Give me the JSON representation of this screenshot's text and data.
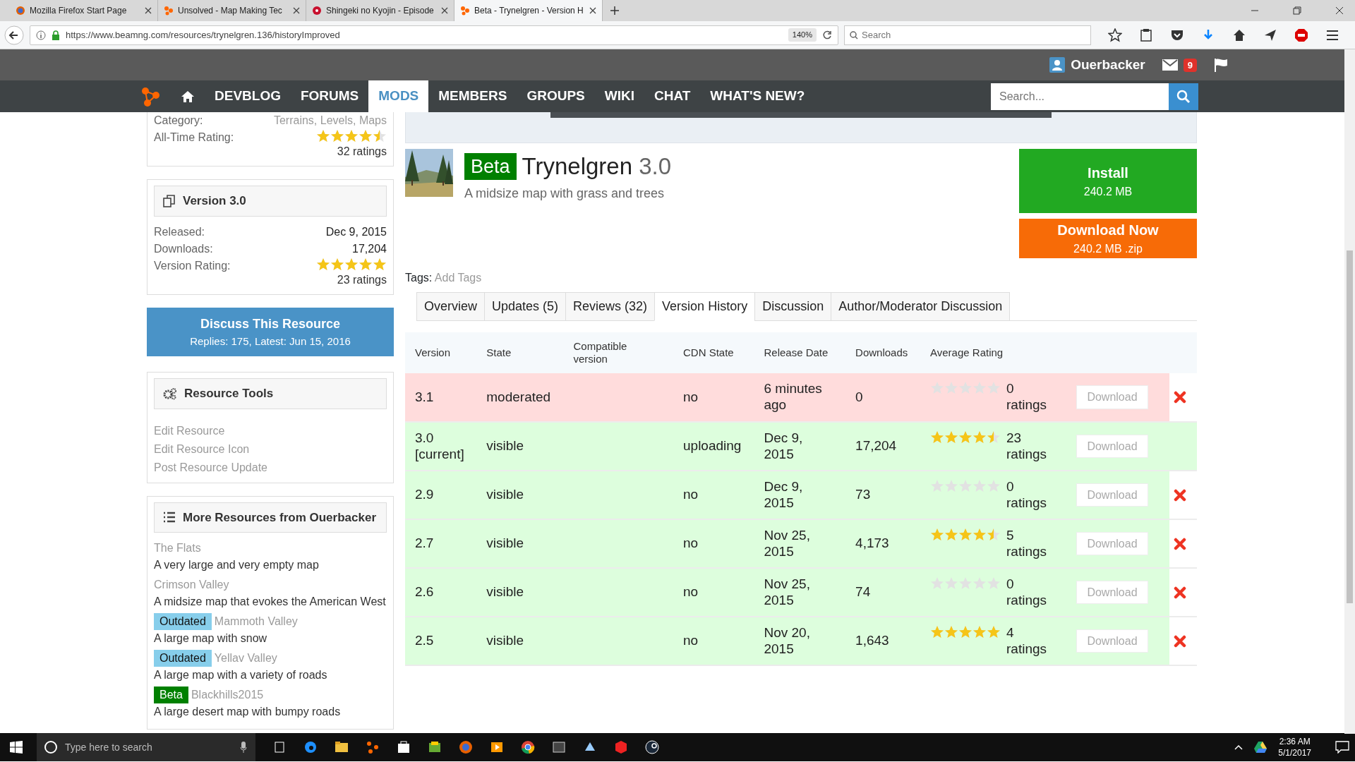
{
  "browser": {
    "tabs": [
      {
        "title": "Mozilla Firefox Start Page",
        "selected": false
      },
      {
        "title": "Unsolved - Map Making Tec",
        "selected": false
      },
      {
        "title": "Shingeki no Kyojin - Episode",
        "selected": false
      },
      {
        "title": "Beta - Trynelgren - Version H",
        "selected": true
      }
    ],
    "url": "https://www.beamng.com/resources/trynelgren.136/historyImproved",
    "zoom": "140%",
    "search_placeholder": "Search"
  },
  "site": {
    "username": "Ouerbacker",
    "message_count": "9",
    "search_placeholder": "Search...",
    "nav": [
      {
        "label": "DEVBLOG",
        "selected": false
      },
      {
        "label": "FORUMS",
        "selected": false
      },
      {
        "label": "MODS",
        "selected": true
      },
      {
        "label": "MEMBERS",
        "selected": false
      },
      {
        "label": "GROUPS",
        "selected": false
      },
      {
        "label": "WIKI",
        "selected": false
      },
      {
        "label": "CHAT",
        "selected": false
      },
      {
        "label": "WHAT'S NEW?",
        "selected": false
      }
    ]
  },
  "sidebar": {
    "info_rows": [
      {
        "label": "Category:",
        "value": "Terrains, Levels, Maps"
      },
      {
        "label": "All-Time Rating:",
        "stars": 4.5,
        "value": "32 ratings"
      }
    ],
    "version_card": {
      "title": "Version 3.0",
      "rows": [
        {
          "label": "Released:",
          "value": "Dec 9, 2015"
        },
        {
          "label": "Downloads:",
          "value": "17,204"
        },
        {
          "label": "Version Rating:",
          "stars": 5,
          "value": "23 ratings"
        }
      ]
    },
    "discuss": {
      "title": "Discuss This Resource",
      "subtitle": "Replies: 175, Latest: Jun 15, 2016"
    },
    "tools": {
      "title": "Resource Tools",
      "links": [
        "Edit Resource",
        "Edit Resource Icon",
        "Post Resource Update"
      ]
    },
    "more": {
      "title": "More Resources from Ouerbacker",
      "items": [
        {
          "title": "The Flats",
          "description": "A very large and very empty map"
        },
        {
          "title": "Crimson Valley",
          "description": "A midsize map that evokes the American West"
        },
        {
          "badge": "Outdated",
          "color": "#87ceeb",
          "title": "Mammoth Valley",
          "description": "A large map with snow"
        },
        {
          "badge": "Outdated",
          "color": "#87ceeb",
          "title": "Yellav Valley",
          "description": "A large map with a variety of roads"
        },
        {
          "badge": "Beta",
          "color": "#008000",
          "title": "Blackhills2015",
          "description": "A large desert map with bumpy roads"
        }
      ]
    }
  },
  "resource": {
    "badge": "Beta",
    "title": "Trynelgren",
    "version": "3.0",
    "tagline": "A midsize map with grass and trees",
    "install": {
      "label": "Install",
      "size": "240.2 MB"
    },
    "download": {
      "label": "Download Now",
      "size": "240.2 MB .zip"
    },
    "tags_label": "Tags:",
    "tags_link": "Add Tags",
    "tabs": [
      {
        "label": "Overview",
        "selected": false
      },
      {
        "label": "Updates (5)",
        "selected": false
      },
      {
        "label": "Reviews (32)",
        "selected": false
      },
      {
        "label": "Version History",
        "selected": true
      },
      {
        "label": "Discussion",
        "selected": false
      },
      {
        "label": "Author/Moderator Discussion",
        "selected": false
      }
    ]
  },
  "table": {
    "columns": [
      "Version",
      "State",
      "Compatible version",
      "CDN State",
      "Release Date",
      "Downloads",
      "Average Rating"
    ],
    "rows": [
      {
        "kind": "moderated",
        "version": "3.1",
        "state": "moderated",
        "cdn_state": "no",
        "release_date": "6 minutes ago",
        "downloads": "0",
        "stars": 0,
        "ratings": "0 ratings",
        "download": "Download",
        "deletable": true
      },
      {
        "kind": "visible",
        "version": "3.0 [current]",
        "state": "visible",
        "cdn_state": "uploading",
        "release_date": "Dec 9, 2015",
        "downloads": "17,204",
        "stars": 4.5,
        "ratings": "23 ratings",
        "download": "Download",
        "deletable": false
      },
      {
        "kind": "visible",
        "version": "2.9",
        "state": "visible",
        "cdn_state": "no",
        "release_date": "Dec 9, 2015",
        "downloads": "73",
        "stars": 0,
        "ratings": "0 ratings",
        "download": "Download",
        "deletable": true
      },
      {
        "kind": "visible",
        "version": "2.7",
        "state": "visible",
        "cdn_state": "no",
        "release_date": "Nov 25, 2015",
        "downloads": "4,173",
        "stars": 4.5,
        "ratings": "5 ratings",
        "download": "Download",
        "deletable": true
      },
      {
        "kind": "visible",
        "version": "2.6",
        "state": "visible",
        "cdn_state": "no",
        "release_date": "Nov 25, 2015",
        "downloads": "74",
        "stars": 0,
        "ratings": "0 ratings",
        "download": "Download",
        "deletable": true
      },
      {
        "kind": "visible",
        "version": "2.5",
        "state": "visible",
        "cdn_state": "no",
        "release_date": "Nov 20, 2015",
        "downloads": "1,643",
        "stars": 5,
        "ratings": "4 ratings",
        "download": "Download",
        "deletable": true
      }
    ]
  },
  "taskbar": {
    "search_placeholder": "Type here to search",
    "time": "2:36 AM",
    "date": "5/1/2017"
  }
}
